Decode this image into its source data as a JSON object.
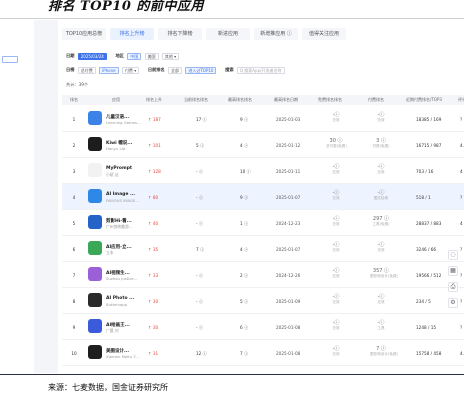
{
  "header": {
    "title": "排名 TOP10 的前中应用"
  },
  "left_panel": {
    "items": [
      "",
      "",
      "",
      "",
      "",
      ""
    ],
    "button_label": ""
  },
  "tabs": [
    {
      "label": "TOP10应用总榜",
      "active": false
    },
    {
      "label": "排名上升榜",
      "active": true
    },
    {
      "label": "排名下降榜",
      "active": false
    },
    {
      "label": "新进应用",
      "active": false
    },
    {
      "label": "新增推应用 ⓘ",
      "active": false
    },
    {
      "label": "值得关注应用",
      "active": false
    }
  ],
  "filters": {
    "row1": {
      "label_date": "日期",
      "date_value": "2025/03/24",
      "label_region": "地区",
      "region_options": [
        "中国",
        "美国",
        "其他 ▾"
      ],
      "region_selected": "中国"
    },
    "row2": {
      "label_type": "日榜",
      "type_options": [
        "总付费",
        "iPhone"
      ],
      "category_label": "付费 ▾",
      "label_rank": "日前排名",
      "rank_options": [
        "全部",
        "进入过TOP10"
      ],
      "label_search": "搜索",
      "search_placeholder": "Q 搜索App/开发者名称"
    }
  },
  "result_count": "共计：39个",
  "table": {
    "headers": [
      "排名",
      "应用",
      "排名上升",
      "当前排名排名",
      "最高排名排名",
      "最高排名日期",
      "免费排名排名",
      "付费排名",
      "近期付费排名/TOP3",
      "评分"
    ],
    "rows": [
      {
        "rank": "1",
        "name": "儿童汉语...",
        "sub": "Learning Games...",
        "change": "↑ 187",
        "trend": "up",
        "a": "17 ⓘ",
        "b": "9 ⓘ",
        "date": "2025-01-03",
        "e": "-ⓘ",
        "e_sub": "无效",
        "f": "-ⓘ",
        "f_sub": "无效",
        "g": "18385 / 169",
        "h": "?",
        "icon_color": "#3b83e6",
        "highlight": false
      },
      {
        "rank": "2",
        "name": "Kiwi 帽说...",
        "sub": "Hanyu Ltd",
        "change": "↑ 101",
        "trend": "up",
        "a": "5 ⓘ",
        "b": "4 ⓘ",
        "date": "2025-01-12",
        "e": "30 ⓘ",
        "e_sub": "总付费(免费)",
        "f": "3 ⓘ",
        "f_sub": "付费(免费)",
        "g": "16715 / 987",
        "h": "4.9",
        "icon_color": "#1d1d1d",
        "highlight": false
      },
      {
        "rank": "3",
        "name": "MyPrompt",
        "sub": "小斌 丛",
        "change": "↑ 128",
        "trend": "up",
        "a": "- ⓘ",
        "b": "10 ⓘ",
        "date": "2025-01-11",
        "e": "-ⓘ",
        "e_sub": "无效",
        "f": "-ⓘ",
        "f_sub": "无效",
        "g": "703 / 16",
        "h": "4",
        "icon_color": "#f2f2f2",
        "highlight": false
      },
      {
        "rank": "4",
        "name": "AI Image ...",
        "sub": "FAMOUS IMAGE...",
        "change": "↑ 80",
        "trend": "up",
        "a": "- ⓘ",
        "b": "9 ⓘ",
        "date": "2025-01-07",
        "e": "-ⓘ",
        "e_sub": "无效",
        "f": "-ⓘ",
        "f_sub": "图文检索",
        "g": "518 / 1",
        "h": "?",
        "icon_color": "#2f88e8",
        "highlight": true
      },
      {
        "rank": "5",
        "name": "剪影Hi-看...",
        "sub": "广州剪映趣游...",
        "change": "↑ 40",
        "trend": "up",
        "a": "- ⓘ",
        "b": "1 ⓘ",
        "date": "2024-12-23",
        "e": "-ⓘ",
        "e_sub": "无效",
        "f": "297 ⓘ",
        "f_sub": "工具(免费)",
        "g": "28837 / 883",
        "h": "4",
        "icon_color": "#2563c9",
        "highlight": false
      },
      {
        "rank": "6",
        "name": "AI应用-立...",
        "sub": "立本",
        "change": "↑ 35",
        "trend": "up",
        "a": "7 ⓘ",
        "b": "4 ⓘ",
        "date": "2025-01-07",
        "e": "-ⓘ",
        "e_sub": "无效",
        "f": "-ⓘ",
        "f_sub": "无效",
        "g": "3246 / 66",
        "h": "?",
        "icon_color": "#3aa856",
        "highlight": false
      },
      {
        "rank": "7",
        "name": "AI视频生...",
        "sub": "Suzhou Justice...",
        "change": "↑ 33",
        "trend": "up",
        "a": "- ⓘ",
        "b": "2 ⓘ",
        "date": "2024-12-26",
        "e": "-ⓘ",
        "e_sub": "无效",
        "f": "357 ⓘ",
        "f_sub": "图形和设计(免费)",
        "g": "19566 / 512",
        "h": "?",
        "icon_color": "#9b5fd8",
        "highlight": false
      },
      {
        "rank": "8",
        "name": "AI Photo ...",
        "sub": "Buttersapp",
        "change": "↑ 30",
        "trend": "up",
        "a": "- ⓘ",
        "b": "5 ⓘ",
        "date": "2025-01-09",
        "e": "-ⓘ",
        "e_sub": "无效",
        "f": "-ⓘ",
        "f_sub": "无效",
        "g": "234 / 5",
        "h": "?",
        "icon_color": "#2b2b2b",
        "highlight": false
      },
      {
        "rank": "9",
        "name": "AI绘画王...",
        "sub": "广晨 刘",
        "change": "↑ 30",
        "trend": "up",
        "a": "- ⓘ",
        "b": "6 ⓘ",
        "date": "2025-01-08",
        "e": "-ⓘ",
        "e_sub": "无效",
        "f": "-ⓘ",
        "f_sub": "工具",
        "g": "1248 / 15",
        "h": "?",
        "icon_color": "#3b5bdb",
        "highlight": false
      },
      {
        "rank": "10",
        "name": "美图设计...",
        "sub": "Xiamen Meitu T...",
        "change": "↑ 31",
        "trend": "up",
        "a": "12 ⓘ",
        "b": "7 ⓘ",
        "date": "2025-01-08",
        "e": "-ⓘ",
        "e_sub": "无效",
        "f": "7 ⓘ",
        "f_sub": "图形和设计(免费)",
        "g": "15758 / 458",
        "h": "4.9",
        "icon_color": "#1e1e1e",
        "highlight": false
      }
    ]
  },
  "side_tools": [
    "chat-icon",
    "grid-icon",
    "print-icon",
    "settings-icon"
  ],
  "footer": {
    "source": "来源：七麦数据，国金证券研究所"
  },
  "colors": {
    "accent": "#3d72e8",
    "rise": "#e8463a",
    "highlight_row": "#eef4ff"
  }
}
